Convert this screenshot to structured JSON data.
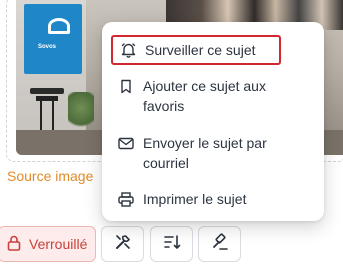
{
  "source": {
    "label": "Source image"
  },
  "photo": {
    "banner_text": "Sovos"
  },
  "menu": {
    "items": [
      {
        "label": "Surveiller ce sujet",
        "icon": "bell-icon"
      },
      {
        "label": "Ajouter ce sujet aux favoris",
        "icon": "bookmark-icon"
      },
      {
        "label": "Envoyer le sujet par courriel",
        "icon": "envelope-icon"
      },
      {
        "label": "Imprimer le sujet",
        "icon": "printer-icon"
      }
    ]
  },
  "toolbar": {
    "lock_label": "Verrouillé",
    "lock_icon": "lock-icon",
    "tools_icon": "wrench-screwdriver-icon",
    "sort_icon": "sort-icon",
    "gavel_icon": "gavel-icon",
    "lock_color": "#c8413a",
    "lock_bg": "#fdeceb"
  },
  "accent": {
    "highlight_border": "#d0282e",
    "source_color": "#e28a28"
  }
}
